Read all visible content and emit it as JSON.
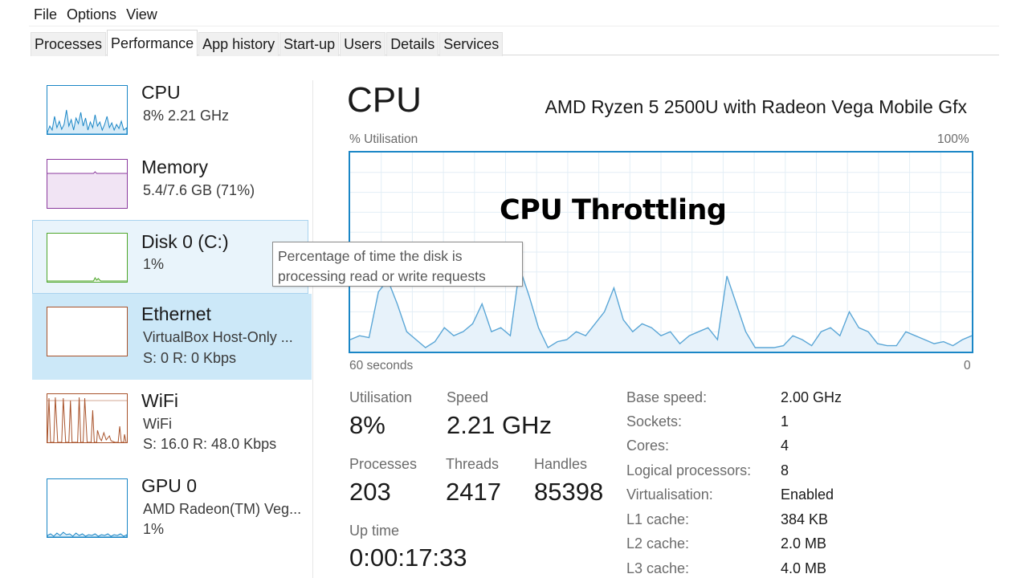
{
  "menu": [
    "File",
    "Options",
    "View"
  ],
  "tabs": [
    "Processes",
    "Performance",
    "App history",
    "Start-up",
    "Users",
    "Details",
    "Services"
  ],
  "active_tab": "Performance",
  "sidebar": {
    "items": [
      {
        "title": "CPU",
        "sub1": "8%  2.21 GHz",
        "color": "#1a86c6"
      },
      {
        "title": "Memory",
        "sub1": "5.4/7.6 GB (71%)",
        "color": "#8b3a9e"
      },
      {
        "title": "Disk 0 (C:)",
        "sub1": "1%",
        "color": "#4da629"
      },
      {
        "title": "Ethernet",
        "sub1": "VirtualBox Host-Only ...",
        "sub2": "S: 0  R: 0 Kbps",
        "color": "#a8522a"
      },
      {
        "title": "WiFi",
        "sub1": "WiFi",
        "sub2": "S: 16.0  R: 48.0 Kbps",
        "color": "#a8522a"
      },
      {
        "title": "GPU 0",
        "sub1": "AMD Radeon(TM) Veg...",
        "sub2": "1%",
        "color": "#1a86c6"
      }
    ]
  },
  "tooltip": {
    "line1": "Percentage of time the disk is",
    "line2": "processing read or write requests"
  },
  "main": {
    "title": "CPU",
    "model": "AMD Ryzen 5 2500U with Radeon Vega Mobile Gfx",
    "graph_label_left": "% Utilisation",
    "graph_label_right": "100%",
    "graph_time_left": "60 seconds",
    "graph_time_right": "0",
    "overlay": "CPU Throttling"
  },
  "stats": {
    "utilisation_label": "Utilisation",
    "utilisation_value": "8%",
    "speed_label": "Speed",
    "speed_value": "2.21 GHz",
    "processes_label": "Processes",
    "processes_value": "203",
    "threads_label": "Threads",
    "threads_value": "2417",
    "handles_label": "Handles",
    "handles_value": "85398",
    "uptime_label": "Up time",
    "uptime_value": "0:00:17:33"
  },
  "specs": [
    {
      "label": "Base speed:",
      "value": "2.00 GHz"
    },
    {
      "label": "Sockets:",
      "value": "1"
    },
    {
      "label": "Cores:",
      "value": "4"
    },
    {
      "label": "Logical processors:",
      "value": "8"
    },
    {
      "label": "Virtualisation:",
      "value": "Enabled"
    },
    {
      "label": "L1 cache:",
      "value": "384 KB"
    },
    {
      "label": "L2 cache:",
      "value": "2.0 MB"
    },
    {
      "label": "L3 cache:",
      "value": "4.0 MB"
    }
  ],
  "cpu_history": [
    6,
    8,
    7,
    30,
    36,
    24,
    10,
    6,
    2,
    5,
    12,
    8,
    10,
    14,
    24,
    10,
    12,
    8,
    42,
    28,
    12,
    2,
    5,
    6,
    10,
    8,
    14,
    20,
    32,
    16,
    10,
    14,
    12,
    8,
    10,
    4,
    8,
    10,
    12,
    6,
    38,
    24,
    10,
    2,
    2,
    2,
    3,
    8,
    6,
    3,
    10,
    12,
    8,
    20,
    12,
    10,
    4,
    3,
    3,
    10,
    8,
    6,
    4,
    5,
    3,
    6,
    8
  ]
}
